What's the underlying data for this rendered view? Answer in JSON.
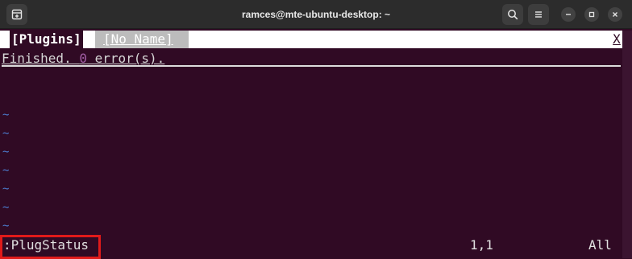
{
  "window": {
    "title": "ramces@mte-ubuntu-desktop: ~",
    "icons": {
      "new_tab": "new-tab-icon",
      "search": "search-icon",
      "menu": "hamburger-menu-icon",
      "minimize": "minimize-icon",
      "maximize": "maximize-icon",
      "close": "close-icon"
    },
    "colors": {
      "terminal_bg": "#300a24",
      "titlebar_bg": "#2c2c2c",
      "highlight_border": "#e11a1a"
    }
  },
  "vim": {
    "tabs": [
      {
        "label": "[Plugins]",
        "active": true
      },
      {
        "label": "[No Name]",
        "active": false
      }
    ],
    "close_label": "X",
    "buffer": {
      "status_prefix": "Finished. ",
      "status_number": "0",
      "status_suffix": " error(s).",
      "tilde": "~"
    },
    "cmdline": ":PlugStatus",
    "ruler": "1,1",
    "position": "All"
  }
}
